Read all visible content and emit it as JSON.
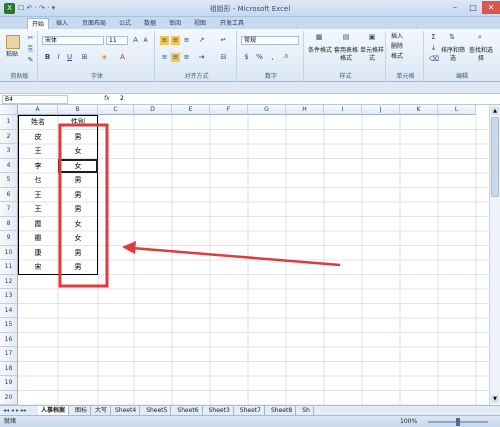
{
  "window": {
    "title": "祖姐形 - Microsoft Excel",
    "qat": "☐ ↶ · ↷ · ▾",
    "controls": [
      "–",
      "□",
      "✕"
    ]
  },
  "tabs": [
    "开始",
    "插入",
    "页面布局",
    "公式",
    "数据",
    "审阅",
    "视图",
    "开发工具"
  ],
  "ribbon": {
    "clipboard": {
      "paste": "粘贴",
      "label": "剪贴板"
    },
    "font": {
      "name": "宋体",
      "size": "11",
      "label": "字体"
    },
    "align": {
      "label": "对齐方式"
    },
    "number": {
      "format": "常规",
      "label": "数字"
    },
    "styles": {
      "cond": "条件格式",
      "table": "套用表格格式",
      "cell": "单元格样式",
      "label": "样式"
    },
    "cells": {
      "insert": "插入",
      "delete": "删除",
      "format": "格式",
      "label": "单元格"
    },
    "edit": {
      "sort": "排序和筛选",
      "find": "查找和选择",
      "label": "编辑"
    }
  },
  "formula_bar": {
    "name_box": "B4",
    "fx": "fx",
    "value": "2"
  },
  "columns": [
    "A",
    "B",
    "C",
    "D",
    "E",
    "F",
    "G",
    "H",
    "I",
    "J",
    "K",
    "L"
  ],
  "rows": [
    "1",
    "2",
    "3",
    "4",
    "5",
    "6",
    "7",
    "8",
    "9",
    "10",
    "11",
    "12",
    "13",
    "14",
    "15",
    "16",
    "17",
    "18",
    "19",
    "20"
  ],
  "cells": {
    "header": [
      "姓名",
      "性别"
    ],
    "data": [
      [
        "皮",
        "男"
      ],
      [
        "王",
        "女"
      ],
      [
        "李",
        "女"
      ],
      [
        "乜",
        "男"
      ],
      [
        "王",
        "男"
      ],
      [
        "王",
        "男"
      ],
      [
        "霞",
        "女"
      ],
      [
        "瓣",
        "女"
      ],
      [
        "康",
        "男"
      ],
      [
        "宋",
        "男"
      ]
    ]
  },
  "sheet_tabs": [
    "人事档案",
    "图标",
    "大写",
    "Sheet4",
    "Sheet5",
    "Sheet6",
    "Sheet3",
    "Sheet7",
    "Sheet8",
    "Sh"
  ],
  "status": {
    "mode": "就绪",
    "zoom": "100%"
  },
  "colors": {
    "highlight": "#e03a3a",
    "arrow": "#e03a3a"
  }
}
